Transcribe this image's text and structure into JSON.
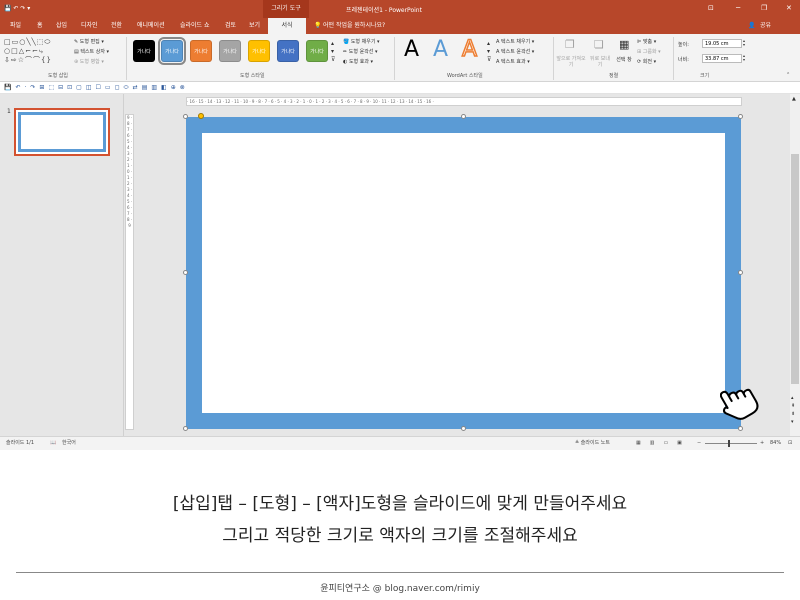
{
  "titlebar": {
    "context_tab": "그리기 도구",
    "title": "프레젠테이션1 - PowerPoint",
    "controls": [
      "⊡",
      "─",
      "❐",
      "✕"
    ]
  },
  "menu": {
    "tabs": [
      "파일",
      "홈",
      "삽입",
      "디자인",
      "전환",
      "애니메이션",
      "슬라이드 쇼",
      "검토",
      "보기"
    ],
    "active_tab": "서식",
    "tell_me": "어떤 작업을 원하시나요?",
    "share": "공유"
  },
  "ribbon": {
    "insert_shapes": {
      "label": "도형 삽입",
      "edit_shape": "도형 편집",
      "text_box": "텍스트 상자",
      "merge_shapes": "도형 병합"
    },
    "shape_styles": {
      "label": "도형 스타일",
      "swatch_text": "가나다",
      "swatches": [
        "#000000",
        "#5b9bd5",
        "#ed7d31",
        "#a5a5a5",
        "#ffc000",
        "#4472c4",
        "#70ad47"
      ],
      "fill": "도형 채우기",
      "outline": "도형 윤곽선",
      "effects": "도형 효과"
    },
    "wordart": {
      "label": "WordArt 스타일",
      "letter": "A",
      "text_fill": "텍스트 채우기",
      "text_outline": "텍스트 윤곽선",
      "text_effects": "텍스트 효과"
    },
    "arrange": {
      "label": "정렬",
      "bring_forward": "앞으로 가져오기",
      "send_backward": "뒤로 보내기",
      "selection_pane": "선택 창",
      "align": "맞춤",
      "group": "그룹화",
      "rotate": "회전"
    },
    "size": {
      "label": "크기",
      "height_label": "높이:",
      "height_value": "19.05 cm",
      "width_label": "너비:",
      "width_value": "33.87 cm"
    }
  },
  "ruler": {
    "horizontal": "· 16 · 15 · 14 · 13 · 12 · 11 · 10 · 9 · 8 · 7 · 6 · 5 · 4 · 3 · 2 · 1 · 0 · 1 · 2 · 3 · 4 · 5 · 6 · 7 · 8 · 9 · 10 · 11 · 12 · 13 · 14 · 15 · 16 ·",
    "vertical": "9 · 8 · 7 · 6 · 5 · 4 · 3 · 2 · 1 · 0 · 1 · 2 · 3 · 4 · 5 · 6 · 7 · 8 · 9"
  },
  "thumbnail": {
    "number": "1"
  },
  "statusbar": {
    "slide_info": "슬라이드 1/1",
    "language": "한국어",
    "notes": "슬라이드 노트",
    "zoom": "84%"
  },
  "caption": {
    "line1": "[삽입]탭 – [도형] – [액자]도형을 슬라이드에 맞게 만들어주세요",
    "line2": "그리고 적당한 크기로 액자의 크기를 조절해주세요",
    "footer": "윤피티연구소 @ blog.naver.com/rimiy"
  }
}
